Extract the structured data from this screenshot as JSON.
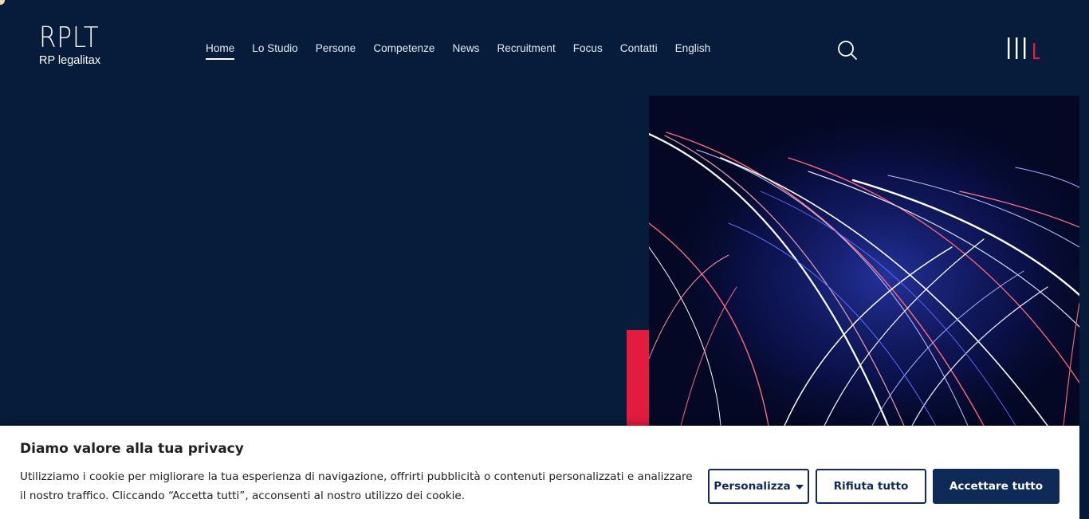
{
  "header": {
    "logo_mark": "RPLT",
    "logo_sub": "RP legalitax",
    "nav": [
      {
        "label": "Home",
        "active": true
      },
      {
        "label": "Lo Studio"
      },
      {
        "label": "Persone"
      },
      {
        "label": "Competenze"
      },
      {
        "label": "News"
      },
      {
        "label": "Recruitment"
      },
      {
        "label": "Focus"
      },
      {
        "label": "Contatti"
      },
      {
        "label": "English"
      }
    ],
    "search_icon": "search-icon",
    "menu_icon": "menu-icon"
  },
  "colors": {
    "background": "#061c3a",
    "accent_red": "#e31b3f",
    "button_navy": "#0f2a56"
  },
  "cookie_banner": {
    "title": "Diamo valore alla tua privacy",
    "text": "Utilizziamo i cookie per migliorare la tua esperienza di navigazione, offrirti pubblicità o contenuti personalizzati e analizzare il nostro traffico. Cliccando “Accetta tutti”, acconsenti al nostro utilizzo dei cookie.",
    "customize_label": "Personalizza",
    "reject_label": "Rifiuta tutto",
    "accept_label": "Accettare tutto"
  }
}
